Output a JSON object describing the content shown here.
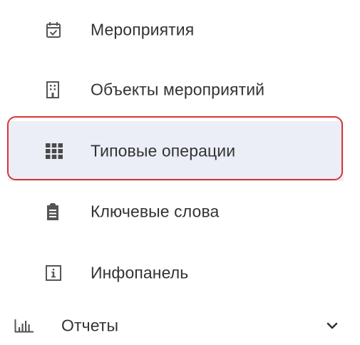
{
  "menu": {
    "items": [
      {
        "label": "Мероприятия",
        "icon": "calendar-check-icon",
        "active": false
      },
      {
        "label": "Объекты мероприятий",
        "icon": "building-icon",
        "active": false
      },
      {
        "label": "Типовые операции",
        "icon": "grid-icon",
        "active": true
      },
      {
        "label": "Ключевые слова",
        "icon": "clipboard-icon",
        "active": false
      },
      {
        "label": "Инфопанель",
        "icon": "info-icon",
        "active": false
      }
    ],
    "group": {
      "label": "Отчеты",
      "icon": "bar-chart-icon",
      "expand_icon": "chevron-down-icon"
    }
  },
  "colors": {
    "text": "#333333",
    "icon": "#555555",
    "active_background": "#eceef7",
    "highlight_border": "#d93535"
  }
}
